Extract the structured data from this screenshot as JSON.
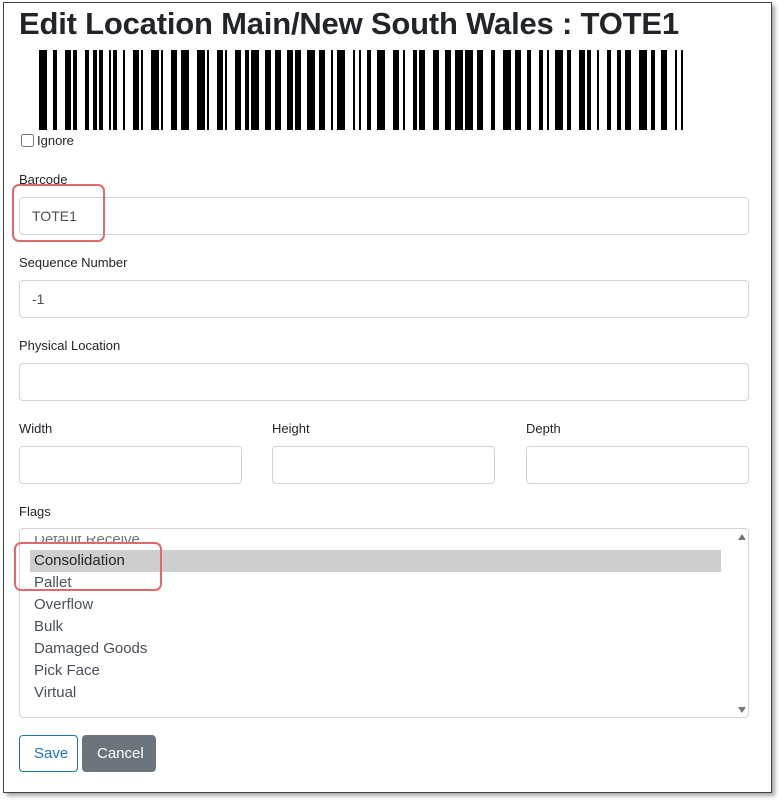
{
  "page": {
    "title": "Edit Location Main/New South Wales : TOTE1"
  },
  "barcode_image": {
    "value": "TOTE1"
  },
  "ignore": {
    "label": "Ignore",
    "checked": false
  },
  "fields": {
    "barcode": {
      "label": "Barcode",
      "value": "TOTE1",
      "placeholder": ""
    },
    "sequence": {
      "label": "Sequence Number",
      "value": "-1",
      "placeholder": ""
    },
    "physical_location": {
      "label": "Physical Location",
      "value": "",
      "placeholder": ""
    },
    "width": {
      "label": "Width",
      "value": "",
      "placeholder": ""
    },
    "height": {
      "label": "Height",
      "value": "",
      "placeholder": ""
    },
    "depth": {
      "label": "Depth",
      "value": "",
      "placeholder": ""
    }
  },
  "flags": {
    "label": "Flags",
    "options": [
      {
        "label": "Default Receive",
        "selected": false
      },
      {
        "label": "Consolidation",
        "selected": true
      },
      {
        "label": "Pallet",
        "selected": false
      },
      {
        "label": "Overflow",
        "selected": false
      },
      {
        "label": "Bulk",
        "selected": false
      },
      {
        "label": "Damaged Goods",
        "selected": false
      },
      {
        "label": "Pick Face",
        "selected": false
      },
      {
        "label": "Virtual",
        "selected": false
      }
    ]
  },
  "buttons": {
    "save": "Save",
    "cancel": "Cancel"
  },
  "colors": {
    "primary_outline": "#1f73b7",
    "secondary": "#6c757d",
    "highlight_annotation": "#e06a6a",
    "selected_option_bg": "#cecece"
  }
}
